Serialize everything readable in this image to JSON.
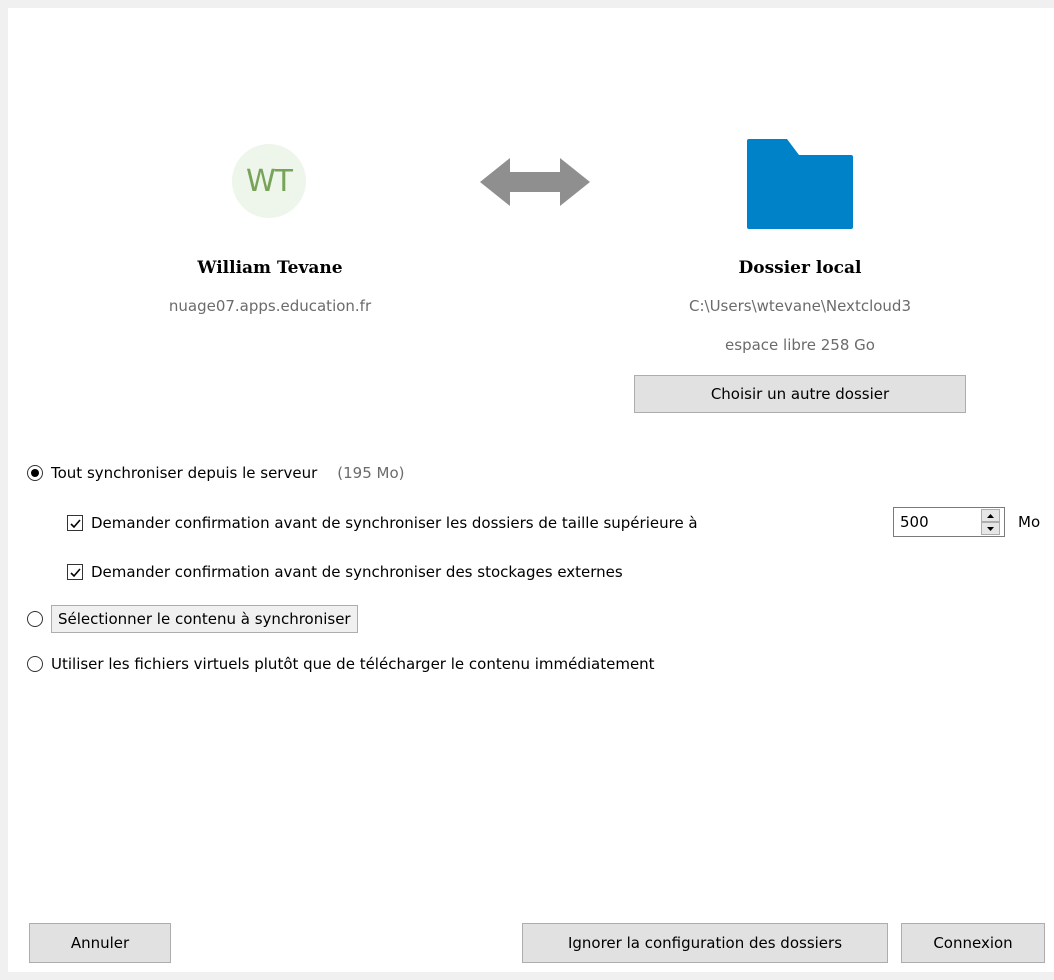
{
  "account": {
    "avatar_initials": "WT",
    "user_name": "William Tevane",
    "server_url": "nuage07.apps.education.fr"
  },
  "local": {
    "title": "Dossier local",
    "path": "C:\\Users\\wtevane\\Nextcloud3",
    "free_space": "espace libre 258 Go",
    "choose_button": "Choisir un autre dossier"
  },
  "options": {
    "sync_all": {
      "label": "Tout synchroniser depuis le serveur",
      "size_note": "(195 Mo)",
      "selected": true
    },
    "confirm_large": {
      "label": "Demander confirmation avant de synchroniser les dossiers de taille supérieure à",
      "checked": true,
      "value": "500",
      "unit": "Mo"
    },
    "confirm_external": {
      "label": "Demander confirmation avant de synchroniser des stockages externes",
      "checked": true
    },
    "select_content": {
      "label": "Sélectionner le contenu à synchroniser",
      "selected": false
    },
    "virtual_files": {
      "label": "Utiliser les fichiers virtuels plutôt que de télécharger le contenu immédiatement",
      "selected": false
    }
  },
  "buttons": {
    "cancel": "Annuler",
    "skip": "Ignorer la configuration des dossiers",
    "connect": "Connexion"
  },
  "colors": {
    "folder": "#0082c9",
    "arrow": "#8f8f8f",
    "avatar_bg": "#eef5ea",
    "avatar_text": "#78a35a"
  },
  "icons": {
    "sync": "bidirectional-arrow-icon",
    "folder": "folder-icon"
  }
}
